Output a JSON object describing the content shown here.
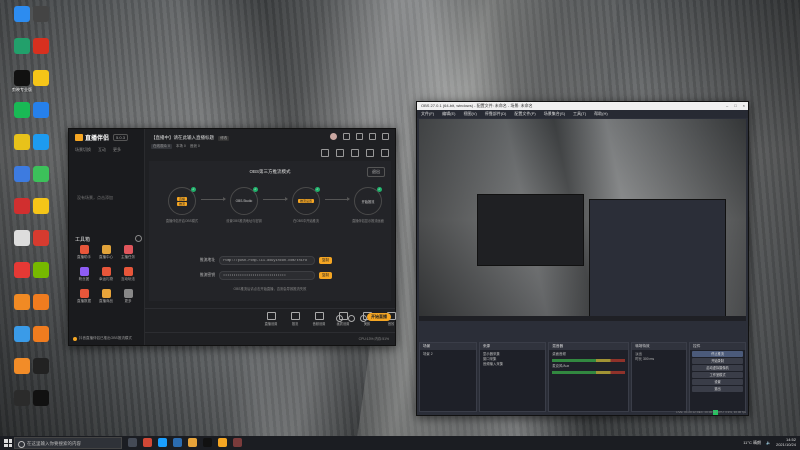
{
  "desktop": {
    "icons": [
      {
        "label": "",
        "color": "#2d8cf0"
      },
      {
        "label": "",
        "color": "#22a06b"
      },
      {
        "label": "剪映专业版",
        "color": "#111111"
      },
      {
        "label": "",
        "color": "#19b955"
      },
      {
        "label": "",
        "color": "#e8c21a"
      },
      {
        "label": "",
        "color": "#3d7be0"
      },
      {
        "label": "",
        "color": "#d12f2f"
      },
      {
        "label": "",
        "color": "#dddddd"
      },
      {
        "label": "",
        "color": "#e53935"
      },
      {
        "label": "",
        "color": "#f08a24"
      },
      {
        "label": "",
        "color": "#3a9be8"
      },
      {
        "label": "",
        "color": "#f28c28"
      },
      {
        "label": "",
        "color": "#2b2b2b"
      },
      {
        "label": "",
        "color": "#444444"
      },
      {
        "label": "",
        "color": "#d7301f"
      },
      {
        "label": "",
        "color": "#f5c518"
      },
      {
        "label": "",
        "color": "#2680eb"
      },
      {
        "label": "",
        "color": "#1d9bf0"
      },
      {
        "label": "",
        "color": "#3cc15a"
      },
      {
        "label": "",
        "color": "#f5c518"
      },
      {
        "label": "",
        "color": "#d63b2f"
      },
      {
        "label": "",
        "color": "#76b900"
      },
      {
        "label": "",
        "color": "#f07c1f"
      },
      {
        "label": "",
        "color": "#f07c1f"
      },
      {
        "label": "",
        "color": "#222222"
      },
      {
        "label": "",
        "color": "#111111"
      }
    ]
  },
  "app": {
    "name": "直播伴侣",
    "version": "5.0.3",
    "left_tabs": [
      "场景切换",
      "互动",
      "更多"
    ],
    "left_empty": "没有场景，点击添加",
    "toolbox_title": "工具箱",
    "tools": [
      {
        "label": "直播助手",
        "color": "#e8563a"
      },
      {
        "label": "直播中心",
        "color": "#e1a33a"
      },
      {
        "label": "主播任务",
        "color": "#e0555b"
      },
      {
        "label": "粉丝团",
        "color": "#8e5cf5"
      },
      {
        "label": "幸运礼物",
        "color": "#e8563a"
      },
      {
        "label": "互动玩法",
        "color": "#e8563a"
      },
      {
        "label": "直播数据",
        "color": "#e8563a"
      },
      {
        "label": "直播商品",
        "color": "#e8a43a"
      },
      {
        "label": "更多",
        "color": "#888888"
      }
    ],
    "bottom_note": "抖音直播伴侣已推出OBS推流模式",
    "room_title": "【直播中】请在此输入直播标题",
    "room_edit": "修改",
    "room_meta": [
      "在线观众 0",
      "本场 0",
      "音浪 0"
    ],
    "mode_title": "OBS第三方推流模式",
    "mode_button": "退出",
    "steps": [
      {
        "chips": [
          "直播",
          "推流"
        ],
        "desc": "直播伴侣开启OBS模式"
      },
      {
        "chips": [],
        "text": "OBS.Studio",
        "desc": "设置OBS推流地址与密钥"
      },
      {
        "chips": [
          "推流设置"
        ],
        "desc": "在OBS中开始推流"
      },
      {
        "chips": [],
        "text": "开始推流",
        "desc": "直播伴侣显示推流画面"
      }
    ],
    "stream_url_label": "推流地址",
    "stream_url_value": "rtmp://push-rtmp-l11.douyincdn.com/third",
    "stream_key_label": "推流密钥",
    "stream_key_value": "••••••••••••••••••••••••••••••",
    "copy_label": "复制",
    "stage_note": "OBS推流后请点击开始直播，否则会导致推流失败",
    "bottom_items": [
      "直播设置",
      "推流",
      "音频设置",
      "画质设置",
      "美颜",
      "音效"
    ],
    "start_live": "开始直播",
    "status_text": "CPU:13% 内存:51%"
  },
  "obs": {
    "title": "OBS 27.0.1 (64-bit, windows) - 配置文件: 未命名 - 场景: 未命名",
    "menu": [
      "文件(F)",
      "编辑(E)",
      "视图(V)",
      "停靠部件(D)",
      "配置文件(P)",
      "场景集合(S)",
      "工具(T)",
      "帮助(H)"
    ],
    "docks": {
      "scenes": {
        "title": "场景",
        "items": [
          "场景 2"
        ]
      },
      "sources": {
        "title": "来源",
        "items": [
          "显示器采集",
          "窗口采集",
          "音频输入采集"
        ]
      },
      "mixer": {
        "title": "混音器",
        "items": [
          "桌面音频",
          "麦克风/Aux"
        ]
      },
      "transitions": {
        "title": "转场特效",
        "items": [
          "淡出",
          "时长 300 ms"
        ]
      },
      "controls": {
        "title": "控件",
        "buttons": [
          "停止推流",
          "开始录制",
          "启动虚拟摄像机",
          "工作室模式",
          "设置",
          "退出"
        ]
      }
    },
    "status": "LIVE: 00:00:12  REC: 00:00:00  CPU: 3.9%, 30.00 fps"
  },
  "taskbar": {
    "search_placeholder": "在这里输入你要搜索的内容",
    "apps": [
      "#444a55",
      "#d14836",
      "#1a9fff",
      "#2b6cb0",
      "#e8a43a",
      "#111111",
      "#f5a623",
      "#7a3b3b"
    ],
    "weather": "11°C 晴朗",
    "time": "14:52",
    "date": "2021/10/24"
  }
}
